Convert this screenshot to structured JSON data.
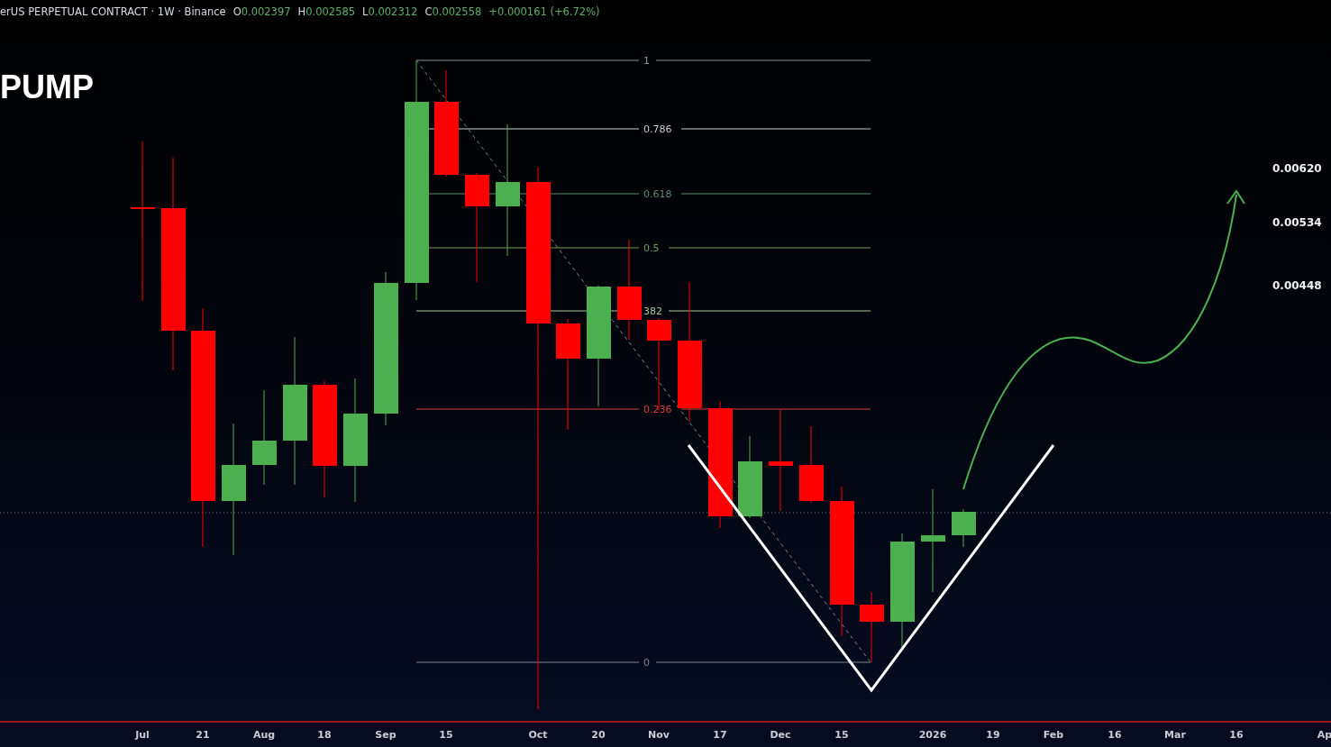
{
  "header": {
    "symbol": "erUS PERPETUAL CONTRACT · 1W · Binance",
    "ohlc": [
      {
        "label": "O",
        "value": "0.002397"
      },
      {
        "label": "H",
        "value": "0.002585"
      },
      {
        "label": "L",
        "value": "0.002312"
      },
      {
        "label": "C",
        "value": "0.002558"
      }
    ],
    "change": "+0.000161 (+6.72%)"
  },
  "title": "PUMP",
  "fib_levels": [
    {
      "label": "1",
      "color": "#8a9aa6"
    },
    {
      "label": "0.786",
      "color": "#c8d0d8"
    },
    {
      "label": "0.618",
      "color": "#5e8a6a"
    },
    {
      "label": "0.5",
      "color": "#6fa05a"
    },
    {
      "label": "382",
      "color": "#a8c8a0"
    },
    {
      "label": "0.236",
      "color": "#d94040"
    },
    {
      "label": "0",
      "color": "#7a8590"
    }
  ],
  "target_prices": [
    "0.00620",
    "0.00534",
    "0.00448"
  ],
  "time_axis": [
    "Jul",
    "21",
    "Aug",
    "18",
    "Sep",
    "15",
    "Oct",
    "20",
    "Nov",
    "17",
    "Dec",
    "15",
    "2026",
    "19",
    "Feb",
    "16",
    "Mar",
    "16",
    "Ap"
  ]
}
